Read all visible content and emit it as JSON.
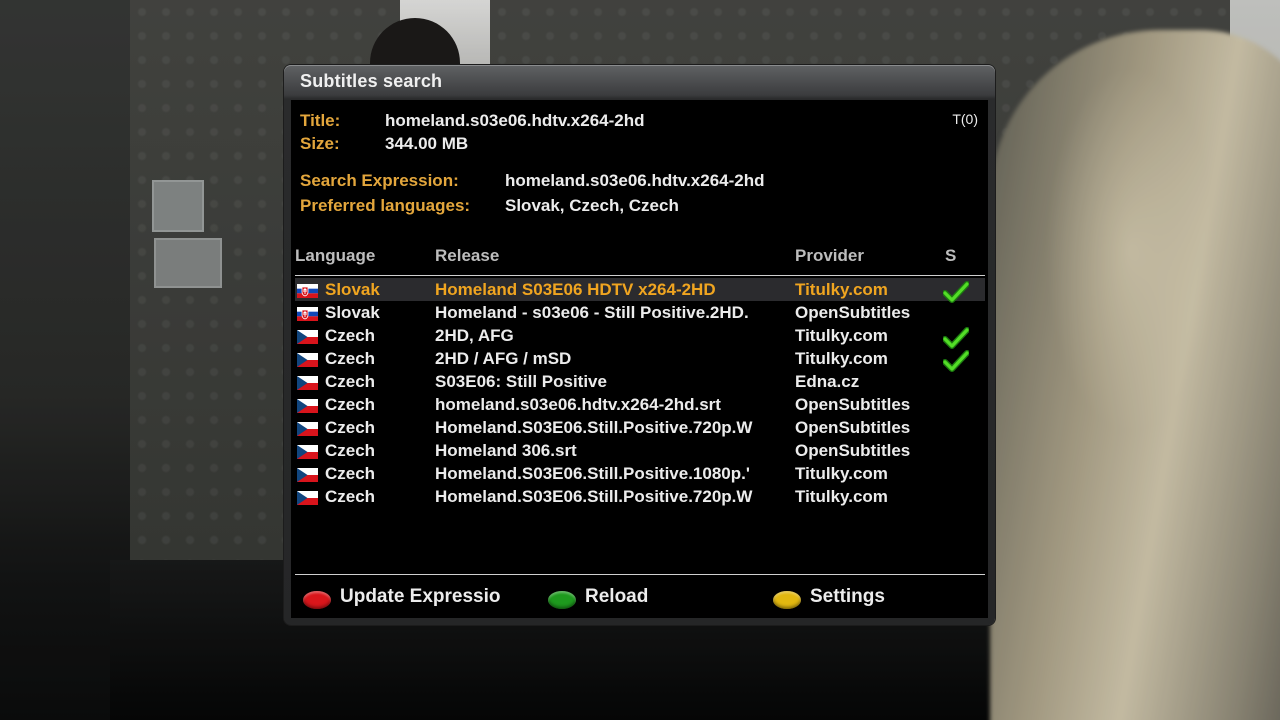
{
  "dialog": {
    "title": "Subtitles search",
    "counter": "T(0)"
  },
  "info": {
    "title_label": "Title:",
    "title_value": "homeland.s03e06.hdtv.x264-2hd",
    "size_label": "Size:",
    "size_value": "344.00 MB",
    "search_label": "Search Expression:",
    "search_value": "homeland.s03e06.hdtv.x264-2hd",
    "pref_label": "Preferred languages:",
    "pref_value": "Slovak, Czech, Czech"
  },
  "table": {
    "headers": {
      "language": "Language",
      "release": "Release",
      "provider": "Provider",
      "sync": "S"
    },
    "rows": [
      {
        "language": "Slovak",
        "flag": "slovak-flag",
        "release": "Homeland S03E06 HDTV x264-2HD",
        "provider": "Titulky.com",
        "synced": true,
        "selected": true
      },
      {
        "language": "Slovak",
        "flag": "slovak-flag",
        "release": "Homeland - s03e06 - Still Positive.2HD.",
        "provider": "OpenSubtitles",
        "synced": false,
        "selected": false
      },
      {
        "language": "Czech",
        "flag": "czech-flag",
        "release": "2HD, AFG",
        "provider": "Titulky.com",
        "synced": true,
        "selected": false
      },
      {
        "language": "Czech",
        "flag": "czech-flag",
        "release": "2HD / AFG / mSD",
        "provider": "Titulky.com",
        "synced": true,
        "selected": false
      },
      {
        "language": "Czech",
        "flag": "czech-flag",
        "release": "S03E06: Still Positive",
        "provider": "Edna.cz",
        "synced": false,
        "selected": false
      },
      {
        "language": "Czech",
        "flag": "czech-flag",
        "release": "homeland.s03e06.hdtv.x264-2hd.srt",
        "provider": "OpenSubtitles",
        "synced": false,
        "selected": false
      },
      {
        "language": "Czech",
        "flag": "czech-flag",
        "release": "Homeland.S03E06.Still.Positive.720p.W",
        "provider": "OpenSubtitles",
        "synced": false,
        "selected": false
      },
      {
        "language": "Czech",
        "flag": "czech-flag",
        "release": "Homeland 306.srt",
        "provider": "OpenSubtitles",
        "synced": false,
        "selected": false
      },
      {
        "language": "Czech",
        "flag": "czech-flag",
        "release": "Homeland.S03E06.Still.Positive.1080p.'",
        "provider": "Titulky.com",
        "synced": false,
        "selected": false
      },
      {
        "language": "Czech",
        "flag": "czech-flag",
        "release": "Homeland.S03E06.Still.Positive.720p.W",
        "provider": "Titulky.com",
        "synced": false,
        "selected": false
      }
    ]
  },
  "buttons": {
    "red": {
      "label": "Update Expressio",
      "color": "#d9161b"
    },
    "green": {
      "label": "Reload",
      "color": "#1e9a1e"
    },
    "yellow": {
      "label": "Settings",
      "color": "#e2b810"
    }
  },
  "colors": {
    "accent": "#e3a63c",
    "selected_text": "#f0a520",
    "check": "#44d21e"
  }
}
